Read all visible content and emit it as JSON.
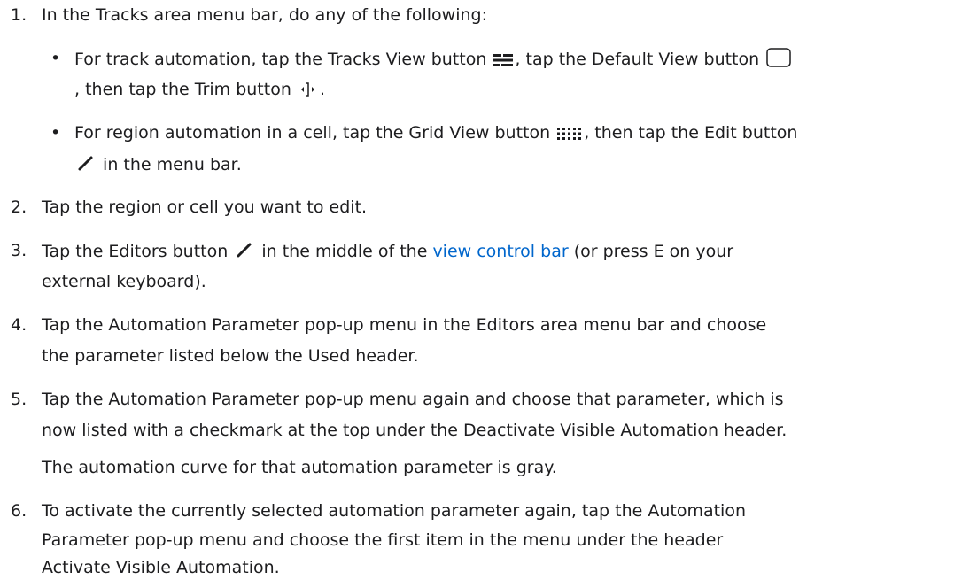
{
  "steps": {
    "s1": {
      "num": "1.",
      "text": "In the Tracks area menu bar, do any of the following:",
      "bullet_a": {
        "p1": "For track automation, tap the Tracks View button",
        "p2": ", tap the Default View button",
        "p3": ", then tap the Trim button",
        "p4": "."
      },
      "bullet_b": {
        "p1": "For region automation in a cell, tap the Grid View button",
        "p2": ", then tap the Edit button",
        "p3": "in the menu bar."
      }
    },
    "s2": {
      "num": "2.",
      "text": "Tap the region or cell you want to edit."
    },
    "s3": {
      "num": "3.",
      "p1": "Tap the Editors button",
      "p2": "in the middle of the",
      "link": "view control bar",
      "p3": "(or press E on your",
      "p4": "external keyboard)."
    },
    "s4": {
      "num": "4.",
      "l1": "Tap the Automation Parameter pop-up menu in the Editors area menu bar and choose",
      "l2": "the parameter listed below the Used header."
    },
    "s5": {
      "num": "5.",
      "l1": "Tap the Automation Parameter pop-up menu again and choose that parameter, which is",
      "l2": "now listed with a checkmark at the top under the Deactivate Visible Automation header.",
      "note": "The automation curve for that automation parameter is gray."
    },
    "s6": {
      "num": "6.",
      "l1": "To activate the currently selected automation parameter again, tap the Automation",
      "l2": "Parameter pop-up menu and choose the first item in the menu under the header",
      "l3": "Activate Visible Automation."
    },
    "bullet_glyph": "•",
    "icons": [
      "tracks-view-icon",
      "default-view-icon",
      "trim-icon",
      "grid-view-icon",
      "edit-pencil-icon",
      "editors-pencil-icon"
    ],
    "link_color": "#0066cc"
  }
}
